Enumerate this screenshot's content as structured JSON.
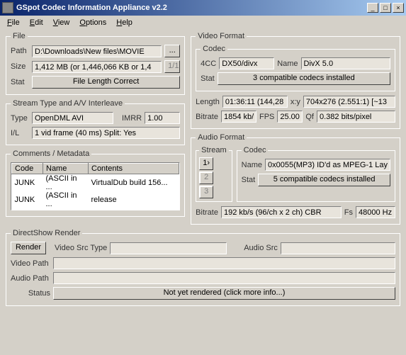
{
  "window": {
    "title": "GSpot Codec Information Appliance   v2.2"
  },
  "menu": [
    "File",
    "Edit",
    "View",
    "Options",
    "Help"
  ],
  "file": {
    "legend": "File",
    "path_label": "Path",
    "path": "D:\\Downloads\\New files\\MOVIE",
    "browse": "...",
    "size_label": "Size",
    "size": "1,412 MB (or 1,446,066 KB or 1,4",
    "ratio": "1/1",
    "stat_label": "Stat",
    "stat": "File Length Correct"
  },
  "stream": {
    "legend": "Stream Type and A/V Interleave",
    "type_label": "Type",
    "type": "OpenDML AVI",
    "imrr_label": "IMRR",
    "imrr": "1.00",
    "il_label": "I/L",
    "il": "1 vid frame (40 ms)  Split: Yes"
  },
  "comments": {
    "legend": "Comments / Metadata",
    "headers": {
      "code": "Code",
      "name": "Name",
      "contents": "Contents"
    },
    "rows": [
      {
        "code": "JUNK",
        "name": "(ASCII in ...",
        "contents": "VirtualDub build 156..."
      },
      {
        "code": "JUNK",
        "name": "(ASCII in ...",
        "contents": "release"
      }
    ]
  },
  "video": {
    "legend": "Video Format",
    "codec_legend": "Codec",
    "fourcc_label": "4CC",
    "fourcc": "DX50/divx",
    "name_label": "Name",
    "name": "DivX 5.0",
    "stat_label": "Stat",
    "stat": "3 compatible codecs installed",
    "length_label": "Length",
    "length": "01:36:11 (144,28",
    "xy_label": "x:y",
    "xy": "704x276 (2.551:1) [~13",
    "bitrate_label": "Bitrate",
    "bitrate": "1854 kb/",
    "fps_label": "FPS",
    "fps": "25.00",
    "qf_label": "Qf",
    "qf": "0.382 bits/pixel"
  },
  "audio": {
    "legend": "Audio Format",
    "stream_legend": "Stream",
    "codec_legend": "Codec",
    "stream_buttons": [
      "1›",
      "2",
      "3"
    ],
    "name_label": "Name",
    "name": "0x0055(MP3) ID'd as MPEG-1 Lay",
    "stat_label": "Stat",
    "stat": "5 compatible codecs installed",
    "bitrate_label": "Bitrate",
    "bitrate": "192 kb/s (96/ch x 2 ch) CBR",
    "fs_label": "Fs",
    "fs": "48000 Hz"
  },
  "render": {
    "legend": "DirectShow Render",
    "render_btn": "Render",
    "vsrc_type_label": "Video Src Type",
    "vsrc_type": "",
    "asrc_label": "Audio Src",
    "asrc": "",
    "vpath_label": "Video Path",
    "vpath": "",
    "apath_label": "Audio Path",
    "apath": "",
    "status_label": "Status",
    "status": "Not yet rendered (click more info...)"
  }
}
